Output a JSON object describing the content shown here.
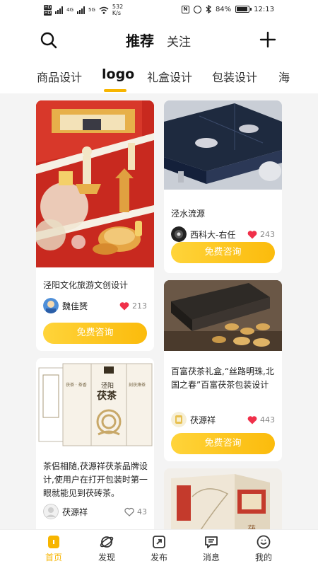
{
  "status_bar": {
    "sim1": "HD",
    "sim2": "HD",
    "net1": "4G",
    "net2": "5G",
    "speed_value": "532",
    "speed_unit": "K/s",
    "nfc": "N",
    "battery": "84%",
    "time": "12:13"
  },
  "header": {
    "recommend_label": "推荐",
    "follow_label": "关注"
  },
  "categories": {
    "items": [
      "商品设计",
      "logo",
      "礼盒设计",
      "包装设计",
      "海"
    ],
    "active_index": 1
  },
  "feed": {
    "cards": [
      {
        "title": "泾阳文化旅游文创设计",
        "author": "魏佳赟",
        "likes": "213",
        "liked": true,
        "button": "免费咨询"
      },
      {
        "title": "泾水流源",
        "author": "西科大-右任",
        "likes": "243",
        "liked": true,
        "button": "免费咨询"
      },
      {
        "title": "百富茯茶礼盒,“丝路明珠,北国之春”百富茯茶包装设计",
        "author": "茯源祥",
        "likes": "443",
        "liked": true,
        "button": "免费咨询"
      },
      {
        "title": "茶侣相随,茯源祥茯茶品牌设计,使用户在打开包装时第一眼就能见到茯砖茶。",
        "author": "茯源祥",
        "likes": "43",
        "liked": false
      }
    ],
    "image_text": {
      "box_brand": "泾阳",
      "box_product": "茯茶",
      "box_side_left": "茯茶 · 茶香",
      "box_side_right": "刻茯烽茶",
      "box_label": "茯"
    }
  },
  "tabbar": {
    "items": [
      {
        "label": "首页",
        "icon": "home-icon",
        "active": true
      },
      {
        "label": "发现",
        "icon": "planet-icon",
        "active": false
      },
      {
        "label": "发布",
        "icon": "publish-icon",
        "active": false
      },
      {
        "label": "消息",
        "icon": "message-icon",
        "active": false
      },
      {
        "label": "我的",
        "icon": "profile-icon",
        "active": false
      }
    ]
  },
  "colors": {
    "accent": "#f7b500",
    "like_red": "#f0304a",
    "button_gradient_start": "#ffd43a",
    "button_gradient_end": "#fbbb0c"
  }
}
